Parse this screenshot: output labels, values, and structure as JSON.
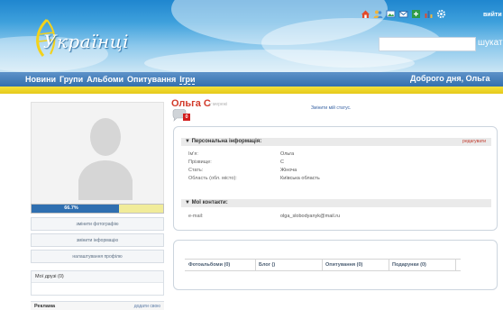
{
  "header": {
    "logo_text": "Українці",
    "logout_label": "вийти",
    "search_button_label": "шукати",
    "top_icons": [
      "home-icon",
      "people-icon",
      "photo-icon",
      "mail-icon",
      "games-icon",
      "chart-icon",
      "settings-icon"
    ]
  },
  "nav": {
    "items": [
      "Новини",
      "Групи",
      "Альбоми",
      "Опитування",
      "Ігри"
    ],
    "active": "Ігри",
    "greeting": "Доброго дня, Ольга"
  },
  "sidebar": {
    "progress_label": "66.7%",
    "progress_value": 0.667,
    "buttons": [
      "змінити фотографію",
      "змінити інформацію",
      "налаштування профілю"
    ],
    "friends_title": "Мої друзі (0)",
    "ads_title": "Реклама",
    "ads_link": "додати свою"
  },
  "profile": {
    "name": "Ольга С",
    "online_status": "у мережі",
    "status_link": "Змінити мій статус.",
    "message_count": "0"
  },
  "personal": {
    "title": "Персональна інформація:",
    "edit_link": "редагувати",
    "fields": [
      {
        "label": "Ім'я:",
        "value": "Ольга"
      },
      {
        "label": "Прізвище:",
        "value": "С"
      },
      {
        "label": "Стать:",
        "value": "Жіноча"
      },
      {
        "label": "Область (обл. місто):",
        "value": "Київська область"
      }
    ]
  },
  "contacts": {
    "title": "Мої контакти:",
    "fields": [
      {
        "label": "e-mail:",
        "value": "olga_slobodyanyk@mail.ru"
      }
    ]
  },
  "tabs": [
    "Фотоальбоми (0)",
    "Блог ()",
    "Опитування (0)",
    "Подарунки (0)"
  ],
  "colors": {
    "nav_blue": "#3470ad",
    "stripe_yellow": "#e5c81a",
    "name_red": "#d23a2a",
    "badge_red": "#d21e1e"
  }
}
